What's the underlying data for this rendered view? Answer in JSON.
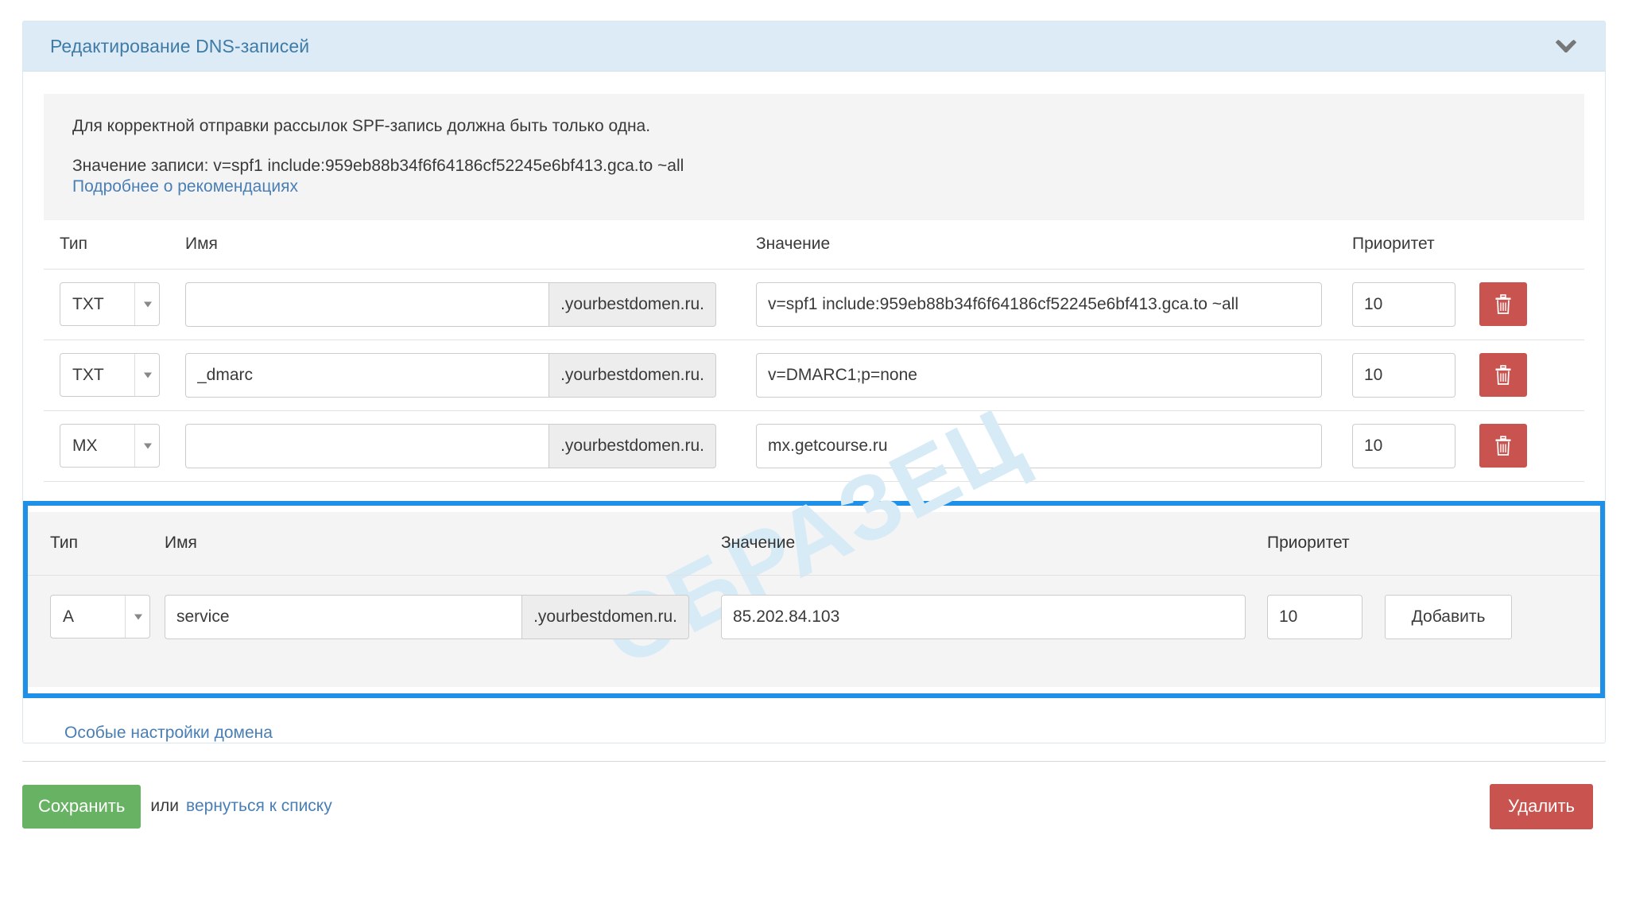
{
  "panel": {
    "title": "Редактирование DNS-записей",
    "collapse_icon": "chevron-down-icon"
  },
  "notice": {
    "line1": "Для корректной отправки рассылок SPF-запись должна быть только одна.",
    "line2": "Значение записи: v=spf1 include:959eb88b34f6f64186cf52245e6bf413.gca.to ~all",
    "link": "Подробнее о рекомендациях"
  },
  "table": {
    "headers": {
      "type": "Тип",
      "name": "Имя",
      "value": "Значение",
      "priority": "Приоритет"
    },
    "domain_suffix": ".yourbestdomen.ru.",
    "name_placeholder": "",
    "delete_icon": "trash-icon",
    "rows": [
      {
        "type": "TXT",
        "name": "",
        "value": "v=spf1 include:959eb88b34f6f64186cf52245e6bf413.gca.to ~all",
        "priority": "10"
      },
      {
        "type": "TXT",
        "name": "_dmarc",
        "value": "v=DMARC1;p=none",
        "priority": "10"
      },
      {
        "type": "MX",
        "name": "",
        "value": "mx.getcourse.ru",
        "priority": "10"
      }
    ]
  },
  "add_block": {
    "highlight_color": "#1e90e8",
    "headers": {
      "type": "Тип",
      "name": "Имя",
      "value": "Значение",
      "priority": "Приоритет"
    },
    "domain_suffix": ".yourbestdomen.ru.",
    "row": {
      "type": "A",
      "name": "service",
      "value": "85.202.84.103",
      "priority": "10"
    },
    "add_button": "Добавить",
    "watermark": "ОБРАЗЕЦ"
  },
  "footer": {
    "special_settings_link": "Особые настройки домена",
    "save_button": "Сохранить",
    "or_text": "или",
    "back_link": "вернуться к списку",
    "delete_button": "Удалить"
  }
}
